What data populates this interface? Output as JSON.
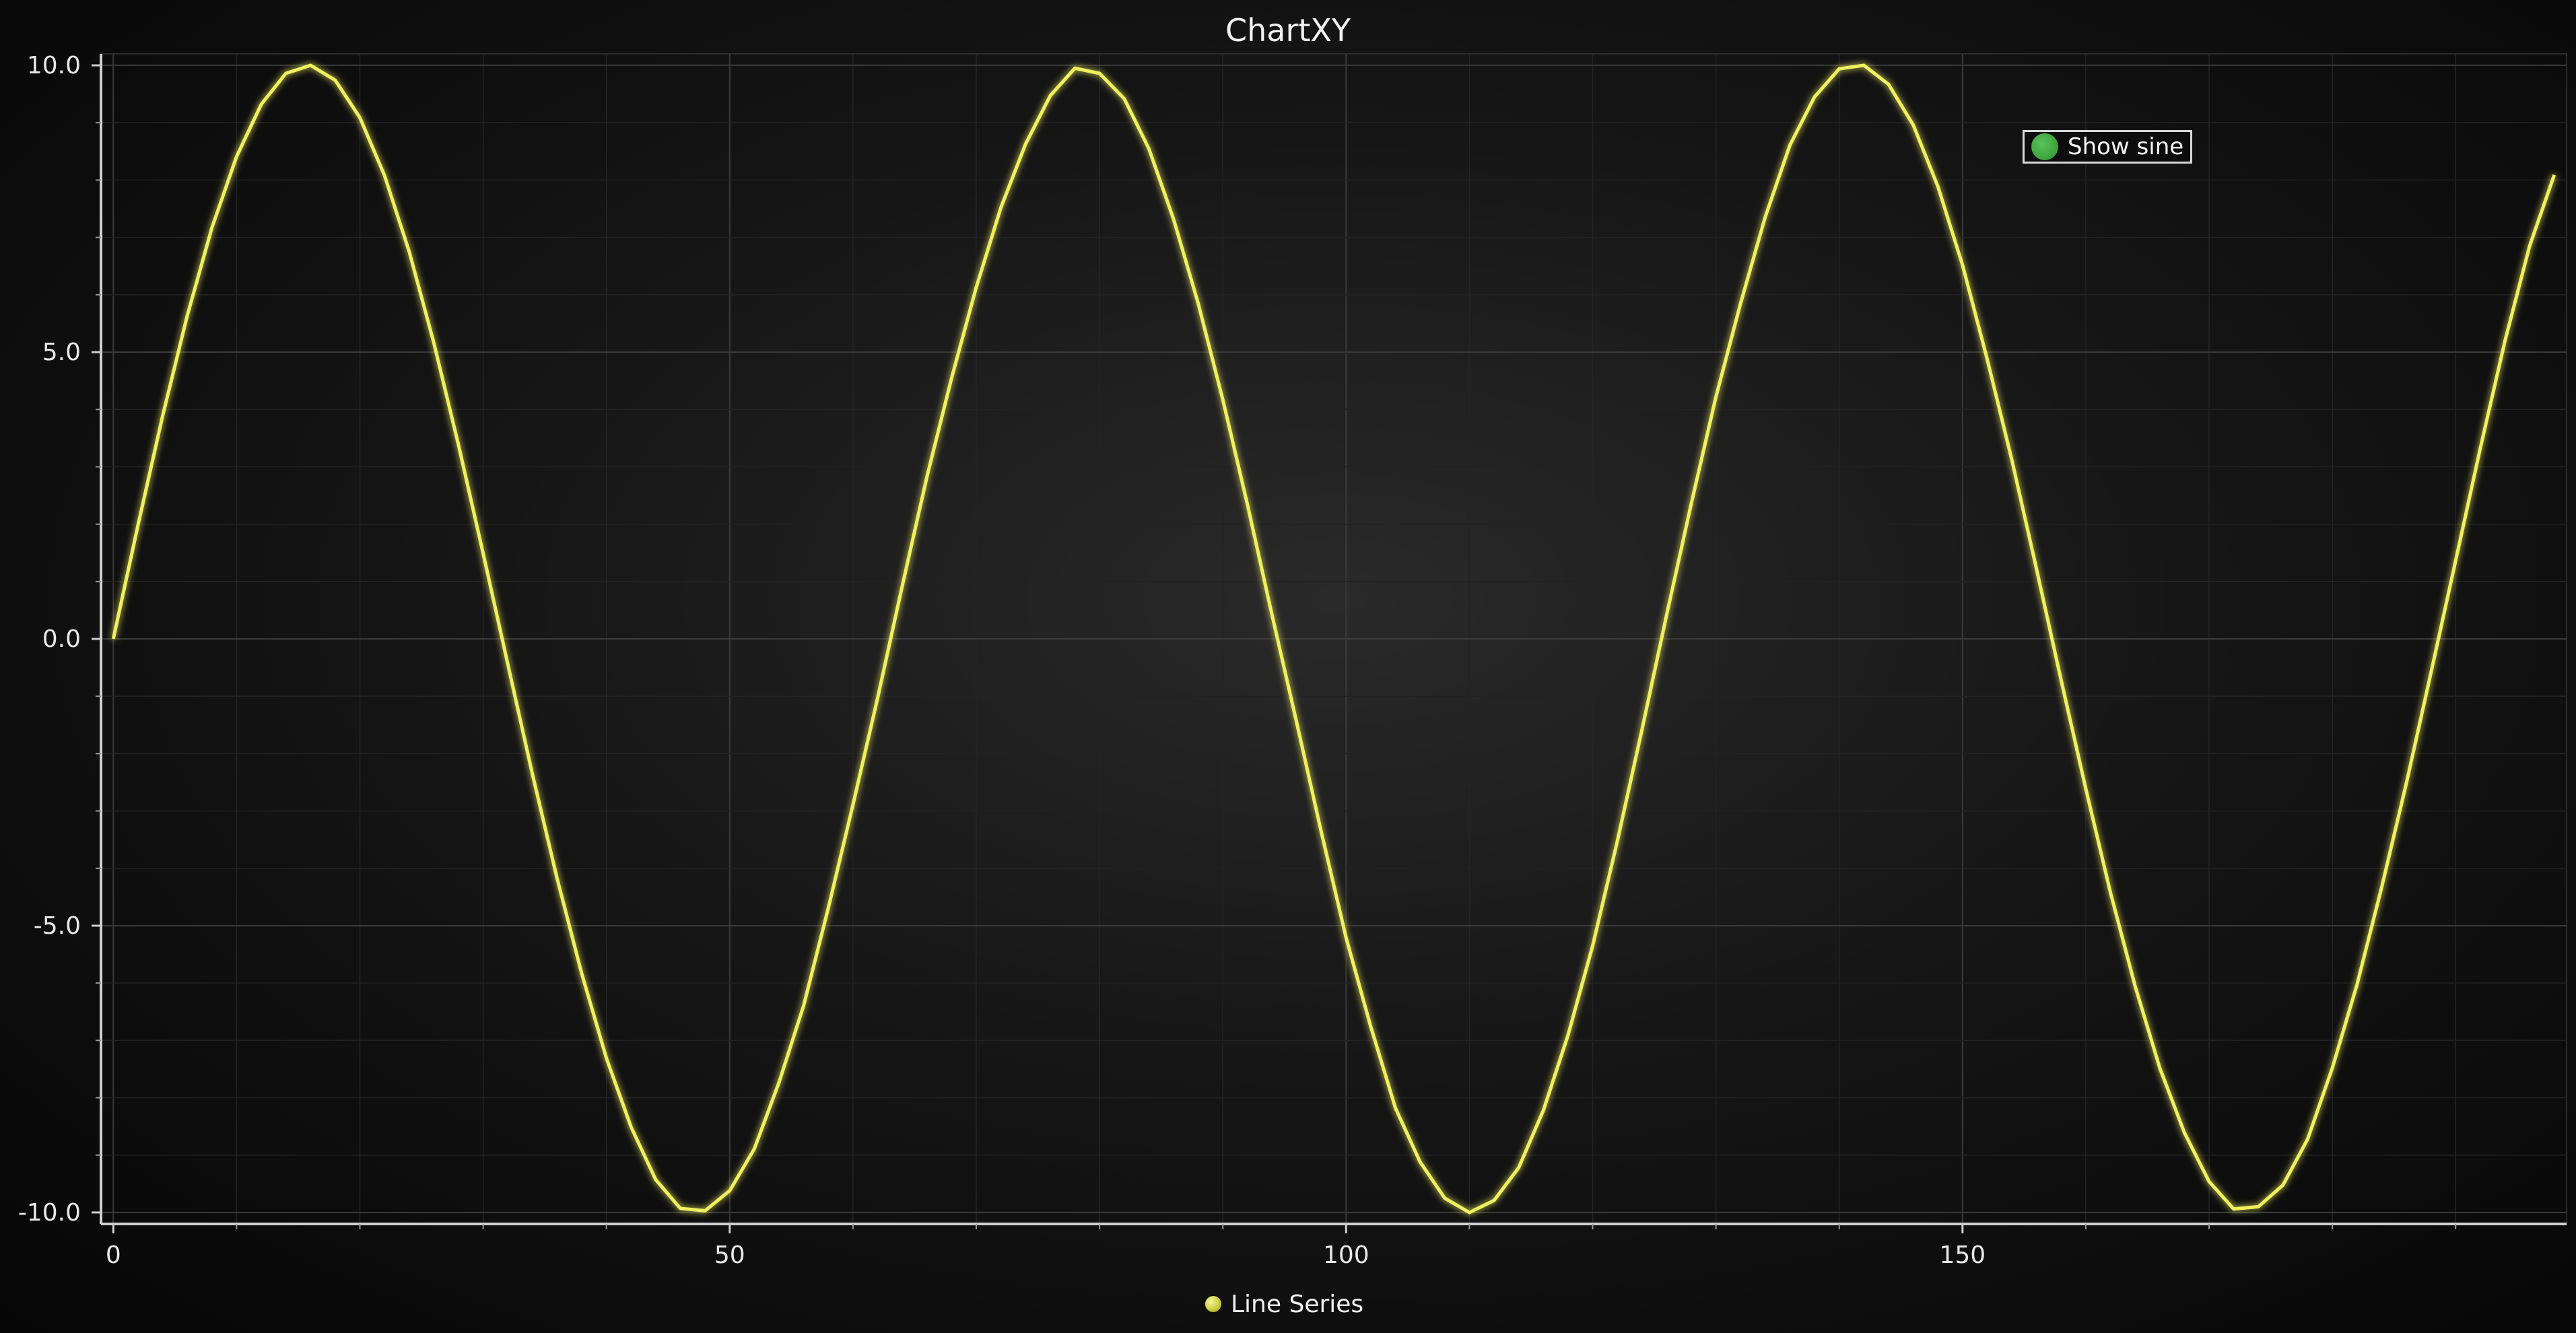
{
  "chart_data": {
    "type": "line",
    "title": "ChartXY",
    "xlabel": "",
    "ylabel": "",
    "xlim": [
      -1,
      199
    ],
    "ylim": [
      -10.2,
      10.2
    ],
    "x_ticks": [
      0,
      50,
      100,
      150
    ],
    "x_tick_labels": [
      "0",
      "50",
      "100",
      "150"
    ],
    "y_ticks": [
      10,
      5,
      0,
      -5,
      -10
    ],
    "y_tick_labels": [
      "10.0",
      "5.0",
      "0.0",
      "-5.0",
      "-10.0"
    ],
    "grid": true,
    "legend_position": "bottom-center",
    "series": [
      {
        "name": "Line Series",
        "color": "#f0f060",
        "x": [
          0,
          2,
          4,
          6,
          8,
          10,
          12,
          14,
          16,
          18,
          20,
          22,
          24,
          26,
          28,
          30,
          32,
          34,
          36,
          38,
          40,
          42,
          44,
          46,
          48,
          50,
          52,
          54,
          56,
          58,
          60,
          62,
          64,
          66,
          68,
          70,
          72,
          74,
          76,
          78,
          80,
          82,
          84,
          86,
          88,
          90,
          92,
          94,
          96,
          98,
          100,
          102,
          104,
          106,
          108,
          110,
          112,
          114,
          116,
          118,
          120,
          122,
          124,
          126,
          128,
          130,
          132,
          134,
          136,
          138,
          140,
          142,
          144,
          146,
          148,
          150,
          152,
          154,
          156,
          158,
          160,
          162,
          164,
          166,
          168,
          170,
          172,
          174,
          176,
          178,
          180,
          182,
          184,
          186,
          188,
          190,
          192,
          194,
          196,
          198
        ],
        "y": [
          0.0,
          1.98,
          3.89,
          5.64,
          7.17,
          8.41,
          9.32,
          9.86,
          10.0,
          9.74,
          9.09,
          8.08,
          6.75,
          5.16,
          3.38,
          1.49,
          -0.44,
          -2.36,
          -4.18,
          -5.84,
          -7.31,
          -8.51,
          -9.43,
          -9.93,
          -9.97,
          -9.62,
          -8.89,
          -7.73,
          -6.39,
          -4.69,
          -2.89,
          -1.03,
          0.93,
          2.83,
          4.55,
          6.13,
          7.52,
          8.63,
          9.47,
          9.95,
          9.86,
          9.42,
          8.55,
          7.32,
          5.85,
          4.17,
          2.34,
          0.41,
          -1.47,
          -3.38,
          -5.21,
          -6.76,
          -8.18,
          -9.12,
          -9.75,
          -10.0,
          -9.79,
          -9.22,
          -8.22,
          -6.91,
          -5.35,
          -3.53,
          -1.58,
          0.42,
          2.36,
          4.22,
          5.85,
          7.36,
          8.61,
          9.45,
          9.94,
          10.0,
          9.67,
          8.96,
          7.89,
          6.52,
          4.88,
          3.12,
          1.22,
          -0.72,
          -2.61,
          -4.42,
          -6.05,
          -7.48,
          -8.61,
          -9.46,
          -9.94,
          -9.9,
          -9.52,
          -8.72,
          -7.48,
          -6.03,
          -4.33,
          -2.52,
          -0.59,
          1.36,
          3.32,
          5.19,
          6.85,
          8.09
        ]
      }
    ]
  },
  "ui": {
    "checkbox_label": "Show sine",
    "checkbox_checked": true,
    "checkbox_color": "#3aa03a"
  }
}
